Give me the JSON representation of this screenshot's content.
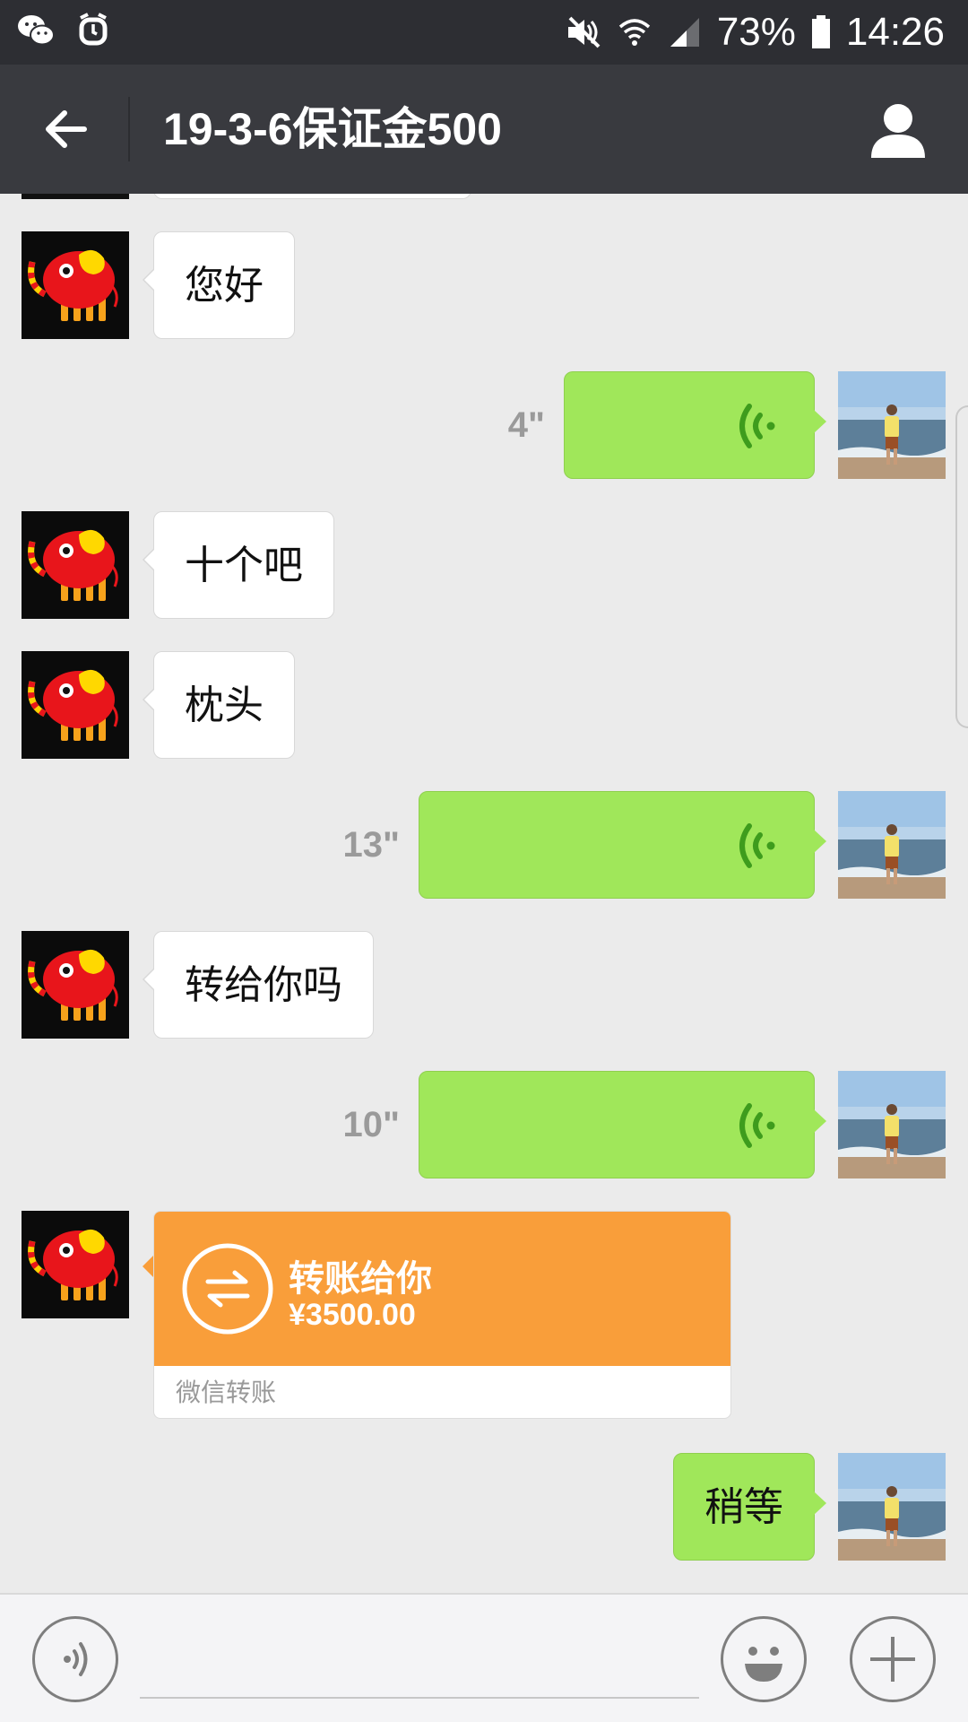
{
  "status_bar": {
    "battery": "73%",
    "time": "14:26",
    "icons": [
      "wechat-icon",
      "alarm-icon",
      "mute-icon",
      "wifi-icon",
      "signal-icon",
      "battery-icon"
    ]
  },
  "header": {
    "title": "19-3-6保证金500",
    "back_icon": "back-arrow-icon",
    "profile_icon": "profile-icon"
  },
  "messages": [
    {
      "side": "in",
      "type": "text",
      "text": "您好"
    },
    {
      "side": "out",
      "type": "voice",
      "duration": "4\""
    },
    {
      "side": "in",
      "type": "text",
      "text": "十个吧"
    },
    {
      "side": "in",
      "type": "text",
      "text": "枕头"
    },
    {
      "side": "out",
      "type": "voice",
      "duration": "13\""
    },
    {
      "side": "in",
      "type": "text",
      "text": "转给你吗"
    },
    {
      "side": "out",
      "type": "voice",
      "duration": "10\""
    },
    {
      "side": "in",
      "type": "transfer",
      "title": "转账给你",
      "amount": "¥3500.00",
      "footer": "微信转账"
    },
    {
      "side": "out",
      "type": "text",
      "text": "稍等"
    }
  ],
  "colors": {
    "outgoing_bubble": "#a0e75a",
    "incoming_bubble": "#ffffff",
    "transfer_card": "#f99e3a",
    "title_bar": "#393a3f",
    "status_bar": "#2d2e33"
  },
  "input_bar": {
    "voice_icon": "voice-input-icon",
    "emoji_icon": "emoji-icon",
    "plus_icon": "plus-icon",
    "value": ""
  }
}
